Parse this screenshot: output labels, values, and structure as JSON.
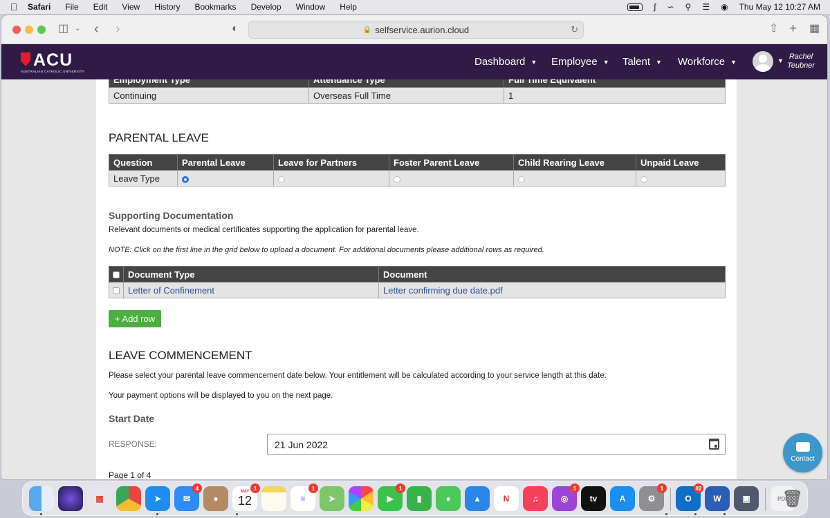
{
  "menubar": {
    "items": [
      "Safari",
      "File",
      "Edit",
      "View",
      "History",
      "Bookmarks",
      "Develop",
      "Window",
      "Help"
    ],
    "clock": "Thu May 12  10:27 AM"
  },
  "browser": {
    "url": "selfservice.aurion.cloud"
  },
  "site": {
    "logo_text": "ACU",
    "logo_subtitle": "AUSTRALIAN CATHOLIC UNIVERSITY",
    "nav": [
      "Dashboard",
      "Employee",
      "Talent",
      "Workforce"
    ],
    "user_first": "Rachel",
    "user_last": "Teubner"
  },
  "employment_table": {
    "headers": [
      "Employment Type",
      "Attendance Type",
      "Full Time Equivalent"
    ],
    "row": [
      "Continuing",
      "Overseas Full Time",
      "1"
    ]
  },
  "parental_leave": {
    "title": "PARENTAL LEAVE",
    "headers": [
      "Question",
      "Parental Leave",
      "Leave for Partners",
      "Foster Parent Leave",
      "Child Rearing Leave",
      "Unpaid Leave"
    ],
    "row_label": "Leave Type",
    "selected_index": 0
  },
  "supporting_docs": {
    "title": "Supporting Documentation",
    "description": "Relevant documents or medical certificates supporting the application for parental leave.",
    "note": "NOTE: Click on the first line in the grid below to upload a document. For additional documents please additional rows as required.",
    "headers": [
      "Document Type",
      "Document"
    ],
    "row": [
      "Letter of Confinement",
      "Letter confirming due date.pdf"
    ],
    "add_row_label": "+ Add row"
  },
  "leave_commencement": {
    "title": "LEAVE COMMENCEMENT",
    "text1": "Please select your parental leave commencement date below. Your entitlement will be calculated according to your service length at this date.",
    "text2": "Your payment options will be displayed to you on the next page.",
    "start_title": "Start Date",
    "response_label": "RESPONSE:",
    "date_value": "21 Jun 2022"
  },
  "page_indicator": "Page 1 of 4",
  "contact_label": "Contact",
  "dock": {
    "calendar_month": "MAY",
    "calendar_day": "12",
    "badges": {
      "mail": "4",
      "calendar": "1",
      "reminders": "1",
      "facetime": "1",
      "podcasts": "1",
      "sysprefs": "1",
      "outlook": "82"
    },
    "colors": {
      "header": "#2f1b45",
      "accent_red": "#e21d2f",
      "add_button": "#4cae3f",
      "contact": "#3d97c8"
    }
  }
}
